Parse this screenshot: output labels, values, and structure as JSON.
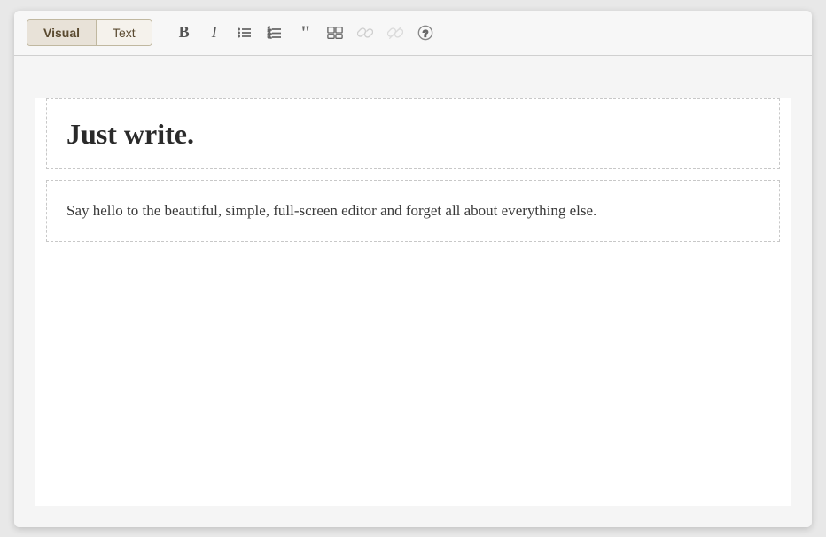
{
  "toolbar": {
    "tab_visual": "Visual",
    "tab_text": "Text",
    "bold_label": "B",
    "italic_label": "I",
    "active_tab": "visual"
  },
  "content": {
    "heading": "Just write.",
    "paragraph": "Say hello to the beautiful, simple, full-screen editor and forget all about everything else."
  }
}
